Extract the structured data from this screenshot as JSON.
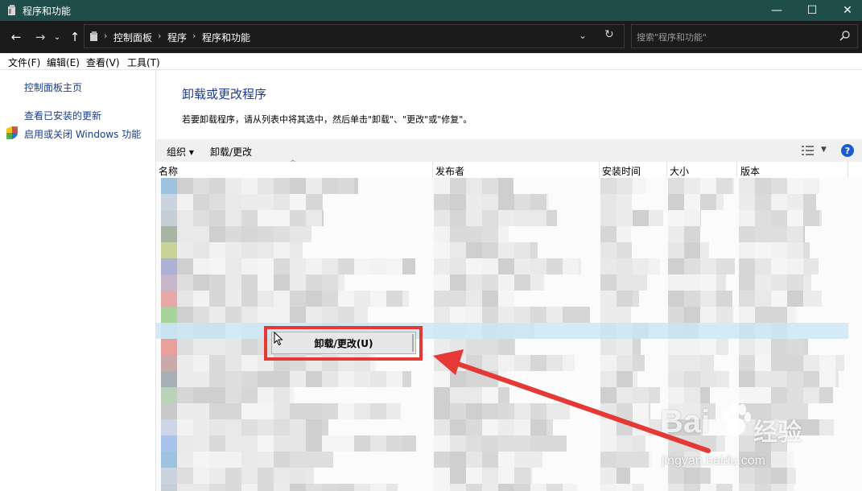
{
  "window": {
    "title": "程序和功能",
    "minimize_glyph": "—",
    "maximize_glyph": "☐",
    "close_glyph": "✕"
  },
  "nav": {
    "back_glyph": "←",
    "forward_glyph": "→",
    "recent_glyph": "⌄",
    "up_glyph": "↑",
    "breadcrumbs": [
      "控制面板",
      "程序",
      "程序和功能"
    ],
    "separator": "›",
    "dropdown_glyph": "⌄",
    "refresh_glyph": "↻"
  },
  "search": {
    "placeholder": "搜索\"程序和功能\"",
    "icon": "search-icon"
  },
  "menu": [
    "文件(F)",
    "编辑(E)",
    "查看(V)",
    "工具(T)"
  ],
  "sidebar": {
    "items": [
      "控制面板主页",
      "查看已安装的更新",
      "启用或关闭 Windows 功能"
    ]
  },
  "main": {
    "heading": "卸载或更改程序",
    "instruction": "若要卸载程序，请从列表中将其选中，然后单击\"卸载\"、\"更改\"或\"修复\"。"
  },
  "toolbar": {
    "organize": "组织 ▾",
    "uninstall_change": "卸载/更改",
    "help": "?"
  },
  "columns": [
    "名称",
    "发布者",
    "安装时间",
    "大小",
    "版本"
  ],
  "context_menu": {
    "item": "卸载/更改(U)"
  },
  "watermark": {
    "brand": "Bai",
    "brand2": "经验",
    "url": "jingyan.baidu.com"
  },
  "colors": {
    "titlebar": "#1f4e4a",
    "navbar": "#1b1b1b",
    "link": "#1a3e8a",
    "heading": "#1e3b8c",
    "highlight": "#e53935",
    "arrow": "#e53935"
  }
}
